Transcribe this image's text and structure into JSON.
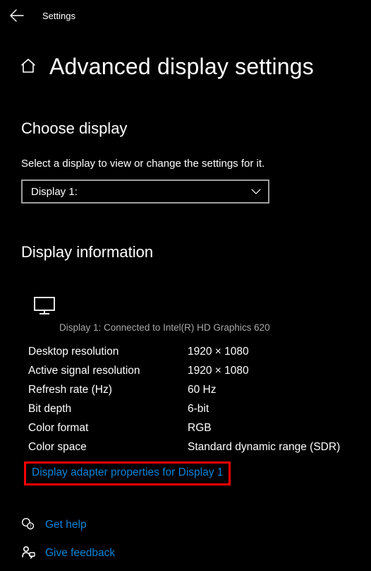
{
  "titlebar": {
    "app_title": "Settings"
  },
  "page": {
    "title": "Advanced display settings"
  },
  "choose": {
    "heading": "Choose display",
    "subtitle": "Select a display to view or change the settings for it.",
    "selected": "Display 1:"
  },
  "info": {
    "heading": "Display information",
    "connected": "Display 1: Connected to Intel(R) HD Graphics 620",
    "rows": [
      {
        "label": "Desktop resolution",
        "value": "1920 × 1080"
      },
      {
        "label": "Active signal resolution",
        "value": "1920 × 1080"
      },
      {
        "label": "Refresh rate (Hz)",
        "value": "60 Hz"
      },
      {
        "label": "Bit depth",
        "value": "6-bit"
      },
      {
        "label": "Color format",
        "value": "RGB"
      },
      {
        "label": "Color space",
        "value": "Standard dynamic range (SDR)"
      }
    ],
    "adapter_link": "Display adapter properties for Display 1"
  },
  "footer": {
    "help": "Get help",
    "feedback": "Give feedback"
  }
}
